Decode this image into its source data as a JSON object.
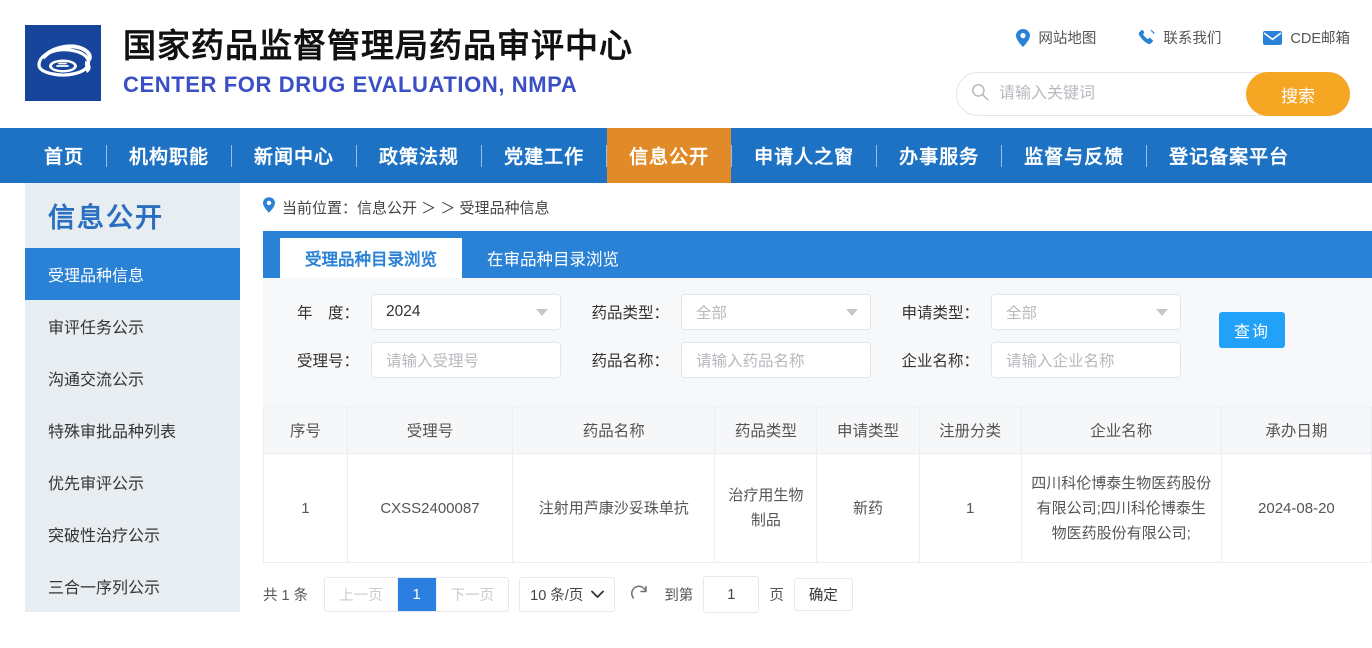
{
  "header": {
    "logo_icon": "cde-fish-logo-icon",
    "title_cn": "国家药品监督管理局药品审评中心",
    "title_en": "CENTER FOR DRUG EVALUATION, NMPA",
    "top_links": [
      {
        "label": "网站地图",
        "icon": "location-pin-icon"
      },
      {
        "label": "联系我们",
        "icon": "phone-icon"
      },
      {
        "label": "CDE邮箱",
        "icon": "envelope-icon"
      }
    ],
    "search": {
      "icon": "search-icon",
      "placeholder": "请输入关键词",
      "value": "",
      "button_label": "搜索"
    }
  },
  "nav": {
    "items": [
      {
        "label": "首页",
        "active": false
      },
      {
        "label": "机构职能",
        "active": false
      },
      {
        "label": "新闻中心",
        "active": false
      },
      {
        "label": "政策法规",
        "active": false
      },
      {
        "label": "党建工作",
        "active": false
      },
      {
        "label": "信息公开",
        "active": true
      },
      {
        "label": "申请人之窗",
        "active": false
      },
      {
        "label": "办事服务",
        "active": false
      },
      {
        "label": "监督与反馈",
        "active": false
      },
      {
        "label": "登记备案平台",
        "active": false
      }
    ]
  },
  "sidebar": {
    "title": "信息公开",
    "items": [
      {
        "label": "受理品种信息",
        "active": true
      },
      {
        "label": "审评任务公示",
        "active": false
      },
      {
        "label": "沟通交流公示",
        "active": false
      },
      {
        "label": "特殊审批品种列表",
        "active": false
      },
      {
        "label": "优先审评公示",
        "active": false
      },
      {
        "label": "突破性治疗公示",
        "active": false
      },
      {
        "label": "三合一序列公示",
        "active": false
      }
    ]
  },
  "breadcrumb": {
    "icon": "location-pin-icon",
    "text": "当前位置：信息公开 ＞ ＞ 受理品种信息"
  },
  "tabs": [
    {
      "label": "受理品种目录浏览",
      "active": true
    },
    {
      "label": "在审品种目录浏览",
      "active": false
    }
  ],
  "filters": {
    "year": {
      "label": "年　度：",
      "value": "2024",
      "type": "select"
    },
    "drug_type": {
      "label": "药品类型：",
      "value": "全部",
      "type": "select"
    },
    "apply_type": {
      "label": "申请类型：",
      "value": "全部",
      "type": "select"
    },
    "accept_no": {
      "label": "受理号：",
      "placeholder": "请输入受理号",
      "value": ""
    },
    "drug_name": {
      "label": "药品名称：",
      "placeholder": "请输入药品名称",
      "value": ""
    },
    "company_name": {
      "label": "企业名称：",
      "placeholder": "请输入企业名称",
      "value": ""
    },
    "query_button": "查询"
  },
  "table": {
    "columns": [
      "序号",
      "受理号",
      "药品名称",
      "药品类型",
      "申请类型",
      "注册分类",
      "企业名称",
      "承办日期"
    ],
    "rows": [
      {
        "seq": "1",
        "accept_no": "CXSS2400087",
        "drug_name": "注射用芦康沙妥珠单抗",
        "drug_type": "治疗用生物制品",
        "apply_type": "新药",
        "reg_class": "1",
        "company": "四川科伦博泰生物医药股份有限公司;四川科伦博泰生物医药股份有限公司;",
        "date": "2024-08-20"
      }
    ]
  },
  "pagination": {
    "total_text": "共 1 条",
    "prev_label": "上一页",
    "current_page": "1",
    "next_label": "下一页",
    "page_size_label": "10 条/页",
    "refresh_icon": "refresh-icon",
    "jump_prefix": "到第",
    "jump_value": "1",
    "jump_suffix": "页",
    "confirm_label": "确定"
  },
  "colors": {
    "nav_blue": "#1d72c4",
    "nav_active_orange": "#e08a28",
    "tab_blue": "#2a82d6",
    "search_btn_orange": "#f5a623",
    "query_btn_blue": "#21a1f8",
    "logo_blue": "#17459b",
    "brand_en_purple": "#3a50c4"
  }
}
